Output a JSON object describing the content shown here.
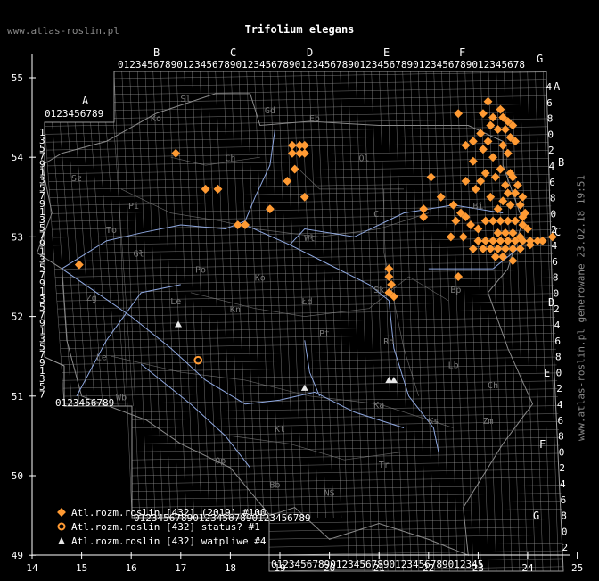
{
  "site_url": "www.atlas-roslin.pl",
  "title": "Trifolium elegans",
  "generated_label": "www.atlas-roslin.pl generowane 23.02.18 19:51",
  "colors": {
    "background": "#000000",
    "grid": "#9a9a9a",
    "border": "#8a8a8a",
    "river": "#8fa8e0",
    "present": "#ff9a33",
    "status_ring": "#ff9a33",
    "doubtful": "#e8e8e8",
    "region_label": "#7a7a7a"
  },
  "axes": {
    "x_ticks": [
      "14",
      "15",
      "16",
      "17",
      "18",
      "19",
      "20",
      "21",
      "22",
      "23",
      "24",
      "25"
    ],
    "y_ticks": [
      "55",
      "54",
      "53",
      "52",
      "51",
      "50",
      "49"
    ]
  },
  "grid_letters": {
    "top": [
      "A",
      "B",
      "C",
      "D",
      "E",
      "F",
      "G"
    ],
    "right": [
      "A",
      "B",
      "C",
      "D",
      "E",
      "F",
      "G"
    ]
  },
  "digit_rows": {
    "top": [
      "0123456789",
      "0123456789",
      "0123456789",
      "0123456789",
      "0123456789",
      "0123456789",
      "012345678"
    ],
    "bottom": [
      "0123456789",
      "0123456789",
      "0123456789"
    ]
  },
  "region_labels": [
    "Sl",
    "Ko",
    "Gd",
    "Eb",
    "Ol",
    "Ch",
    "Pi",
    "Sz",
    "To",
    "Wł",
    "Ci",
    "Bi",
    "Gł",
    "Po",
    "Ko",
    "Zg",
    "Le",
    "Kn",
    "Łd",
    "Pt",
    "Sk",
    "Rd",
    "Bp",
    "Lb",
    "Ch",
    "Zm",
    "Wb",
    "Le",
    "Ka",
    "Kt",
    "Tr",
    "Ks",
    "NS",
    "Bb",
    "Op"
  ],
  "legend": [
    {
      "symbol": "diamond",
      "label": "Atl.rozm.roslin [432] (2019) #100"
    },
    {
      "symbol": "ring",
      "label": "Atl.rozm.roslin [432] status? #1"
    },
    {
      "symbol": "triangle",
      "label": "Atl.rozm.roslin [432] watpliwe #4"
    }
  ],
  "records": {
    "present": [
      [
        16.9,
        54.05
      ],
      [
        17.5,
        53.6
      ],
      [
        17.75,
        53.6
      ],
      [
        18.15,
        53.15
      ],
      [
        18.3,
        53.15
      ],
      [
        18.8,
        53.35
      ],
      [
        19.15,
        53.7
      ],
      [
        19.3,
        53.85
      ],
      [
        19.25,
        54.05
      ],
      [
        19.25,
        54.15
      ],
      [
        19.4,
        54.15
      ],
      [
        19.5,
        54.15
      ],
      [
        19.4,
        54.05
      ],
      [
        19.5,
        54.05
      ],
      [
        19.5,
        53.5
      ],
      [
        14.95,
        52.65
      ],
      [
        21.2,
        52.6
      ],
      [
        21.2,
        52.5
      ],
      [
        21.25,
        52.4
      ],
      [
        21.2,
        52.3
      ],
      [
        21.3,
        52.25
      ],
      [
        22.6,
        52.5
      ],
      [
        22.6,
        54.55
      ],
      [
        23.2,
        54.7
      ],
      [
        23.45,
        54.6
      ],
      [
        23.1,
        54.55
      ],
      [
        23.3,
        54.5
      ],
      [
        23.5,
        54.5
      ],
      [
        23.6,
        54.45
      ],
      [
        23.25,
        54.4
      ],
      [
        23.4,
        54.35
      ],
      [
        23.55,
        54.35
      ],
      [
        23.7,
        54.4
      ],
      [
        23.05,
        54.3
      ],
      [
        23.2,
        54.2
      ],
      [
        23.65,
        54.25
      ],
      [
        23.75,
        54.2
      ],
      [
        22.9,
        54.2
      ],
      [
        22.75,
        54.15
      ],
      [
        23.1,
        54.1
      ],
      [
        23.5,
        54.15
      ],
      [
        23.6,
        54.05
      ],
      [
        23.3,
        54.0
      ],
      [
        22.9,
        53.95
      ],
      [
        23.45,
        53.85
      ],
      [
        23.15,
        53.8
      ],
      [
        23.65,
        53.8
      ],
      [
        23.05,
        53.7
      ],
      [
        22.75,
        53.7
      ],
      [
        22.05,
        53.75
      ],
      [
        23.35,
        53.75
      ],
      [
        23.55,
        53.65
      ],
      [
        23.7,
        53.75
      ],
      [
        23.8,
        53.65
      ],
      [
        23.6,
        53.55
      ],
      [
        23.9,
        53.5
      ],
      [
        22.95,
        53.6
      ],
      [
        23.75,
        53.55
      ],
      [
        23.5,
        53.45
      ],
      [
        23.65,
        53.4
      ],
      [
        23.85,
        53.4
      ],
      [
        23.95,
        53.3
      ],
      [
        23.25,
        53.5
      ],
      [
        23.4,
        53.35
      ],
      [
        21.9,
        53.25
      ],
      [
        21.9,
        53.35
      ],
      [
        22.25,
        53.5
      ],
      [
        22.5,
        53.4
      ],
      [
        22.65,
        53.3
      ],
      [
        22.75,
        53.25
      ],
      [
        22.85,
        53.15
      ],
      [
        23.0,
        53.1
      ],
      [
        22.55,
        53.2
      ],
      [
        22.45,
        53.0
      ],
      [
        22.7,
        53.0
      ],
      [
        23.15,
        53.2
      ],
      [
        23.3,
        53.2
      ],
      [
        23.45,
        53.2
      ],
      [
        23.6,
        53.2
      ],
      [
        23.75,
        53.2
      ],
      [
        23.9,
        53.15
      ],
      [
        24.0,
        53.1
      ],
      [
        23.0,
        52.95
      ],
      [
        23.15,
        52.95
      ],
      [
        23.3,
        52.95
      ],
      [
        23.45,
        52.95
      ],
      [
        23.6,
        52.95
      ],
      [
        23.75,
        52.95
      ],
      [
        23.9,
        52.95
      ],
      [
        24.05,
        52.95
      ],
      [
        24.2,
        52.95
      ],
      [
        22.9,
        52.85
      ],
      [
        23.1,
        52.85
      ],
      [
        23.25,
        52.85
      ],
      [
        23.4,
        52.85
      ],
      [
        23.55,
        52.85
      ],
      [
        23.7,
        52.85
      ],
      [
        23.85,
        52.85
      ],
      [
        24.05,
        52.9
      ],
      [
        24.3,
        52.95
      ],
      [
        24.5,
        53.0
      ],
      [
        23.35,
        52.75
      ],
      [
        23.5,
        52.75
      ],
      [
        23.7,
        52.7
      ],
      [
        23.4,
        53.05
      ],
      [
        23.55,
        53.05
      ],
      [
        23.7,
        53.05
      ],
      [
        23.85,
        53.0
      ],
      [
        23.9,
        53.25
      ]
    ],
    "status": [
      [
        17.35,
        51.45
      ]
    ],
    "doubtful": [
      [
        16.95,
        51.9
      ],
      [
        19.5,
        51.1
      ],
      [
        21.2,
        51.2
      ],
      [
        21.3,
        51.2
      ]
    ]
  }
}
